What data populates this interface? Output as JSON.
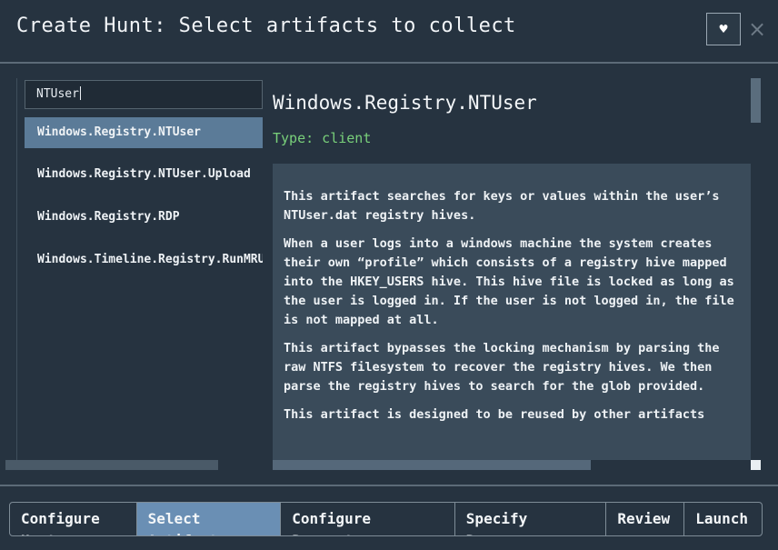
{
  "dialog": {
    "title": "Create Hunt: Select artifacts to collect",
    "favorite_icon": "heart-icon",
    "favorite_glyph": "♥",
    "close_icon": "close-icon",
    "close_glyph": "×"
  },
  "search": {
    "value": "NTUser",
    "placeholder": ""
  },
  "artifacts": [
    {
      "label": "Windows.Registry.NTUser",
      "selected": true
    },
    {
      "label": "Windows.Registry.NTUser.Upload",
      "selected": false
    },
    {
      "label": "Windows.Registry.RDP",
      "selected": false
    },
    {
      "label": "Windows.Timeline.Registry.RunMRU",
      "selected": false
    }
  ],
  "detail": {
    "name": "Windows.Registry.NTUser",
    "type": "Type: client",
    "paragraphs": [
      "This artifact searches for keys or values within the user’s NTUser.dat registry hives.",
      "When a user logs into a windows machine the system creates their own “profile” which consists of a registry hive mapped into the HKEY_USERS hive. This hive file is locked as long as the user is logged in. If the user is not logged in, the file is not mapped at all.",
      "This artifact bypasses the locking mechanism by parsing the raw NTFS filesystem to recover the registry hives. We then parse the registry hives to search for the glob provided.",
      "This artifact is designed to be reused by other artifacts"
    ]
  },
  "wizard_steps": [
    {
      "label": "Configure\nHunt",
      "active": false
    },
    {
      "label": "Select\nArtifacts",
      "active": true
    },
    {
      "label": "Configure\nParameters",
      "active": false
    },
    {
      "label": "Specify\nResources",
      "active": false
    },
    {
      "label": "Review",
      "active": false
    },
    {
      "label": "Launch",
      "active": false
    }
  ],
  "colors": {
    "background": "#263340",
    "selected_item": "#5b7b98",
    "active_step": "#6a8fb4",
    "type_text": "#79d07a",
    "description_bg": "#3a4b5a"
  }
}
